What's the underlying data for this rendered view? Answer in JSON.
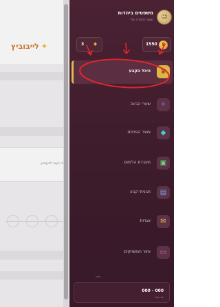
{
  "background_app": {
    "brand": "לייבוביץ",
    "brand_icon": "sparkle-icon",
    "card_text": "את העצי לבעמיע"
  },
  "sidebar": {
    "user": {
      "name": "משפטים ביהדות",
      "subtitle": "מסע הלמידה שלי"
    },
    "stats": {
      "coins": "1550",
      "streak": "3"
    },
    "menu": [
      {
        "label": "היכל הקבע",
        "icon": "crown-icon",
        "active": true
      },
      {
        "label": "שערי הבינה",
        "icon": "sparkles-icon",
        "active": false
      },
      {
        "label": "אוצר הפנינים",
        "icon": "gem-icon",
        "active": false
      },
      {
        "label": "מעבדת הלימוס",
        "icon": "flask-icon",
        "active": false
      },
      {
        "label": "תבניתי קבע",
        "icon": "document-icon",
        "active": false
      },
      {
        "label": "אגרות",
        "icon": "mail-icon",
        "active": false
      },
      {
        "label": "אזור המשחקים",
        "icon": "gamepad-icon",
        "active": false
      }
    ],
    "footer": {
      "label": "רמה",
      "value": "000 - 000",
      "sub": "מד שנה"
    }
  },
  "colors": {
    "sidebar_bg": "#3c1b2a",
    "active_accent": "#e1b544",
    "annotation_red": "#e0262b"
  }
}
